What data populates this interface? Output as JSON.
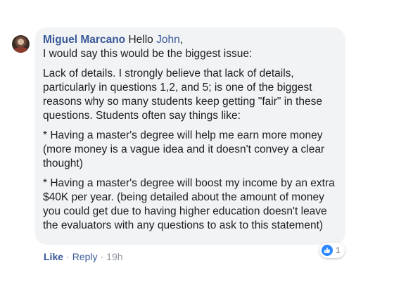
{
  "comment": {
    "author": "Miguel Marcano",
    "greeting": "Hello",
    "mention": "John",
    "greeting_end": ",",
    "line2": "I would say this would be the biggest issue:",
    "para1": "Lack of details. I strongly believe that lack of details, particularly in questions 1,2, and 5; is one of the biggest reasons why so many students keep getting \"fair\" in these questions. Students often say things like:",
    "para2": "* Having a master's degree will help me earn more money (more money is a vague idea and it doesn't convey a clear thought)",
    "para3": "* Having a master's degree will boost my income by an extra $40K per year. (being detailed about the amount of money you could get due to having higher education doesn't leave the evaluators with any questions to ask to this statement)"
  },
  "reaction": {
    "icon": "thumbs-up-icon",
    "count": "1",
    "color": "#2d88ff"
  },
  "actions": {
    "like": "Like",
    "separator": "·",
    "reply": "Reply",
    "time": "19h"
  },
  "colors": {
    "link": "#385898",
    "bubble": "#f2f3f5",
    "meta": "#90949c"
  }
}
